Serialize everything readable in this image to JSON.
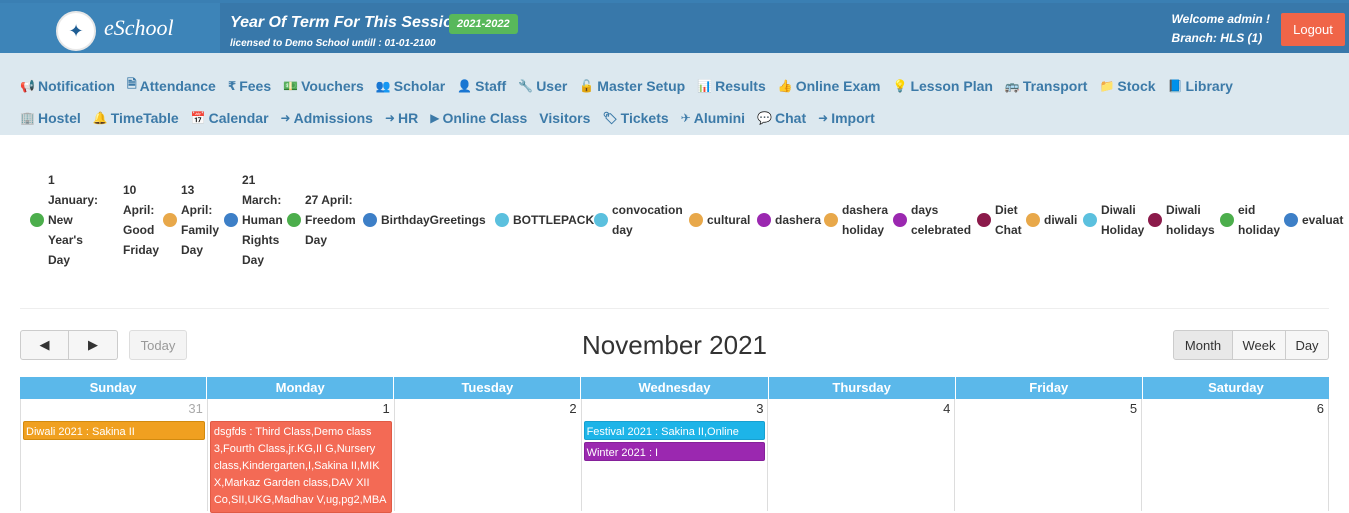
{
  "header": {
    "logo_text": "eSchool",
    "term_title": "Year Of Term For This Session :-",
    "term_badge": "2021-2022",
    "licensed": "licensed to Demo School untill : 01-01-2100",
    "welcome": "Welcome admin !",
    "branch": "Branch: HLS (1)",
    "logout": "Logout"
  },
  "nav": {
    "row1": [
      {
        "label": "Notification",
        "icon": "bullhorn-icon",
        "glyph": "📢"
      },
      {
        "label": "Attendance",
        "icon": "file-icon",
        "glyph": "🗎"
      },
      {
        "label": "Fees",
        "icon": "rupee-icon",
        "glyph": "₹"
      },
      {
        "label": "Vouchers",
        "icon": "money-icon",
        "glyph": "💵"
      },
      {
        "label": "Scholar",
        "icon": "users-icon",
        "glyph": "👥"
      },
      {
        "label": "Staff",
        "icon": "user-icon",
        "glyph": "👤"
      },
      {
        "label": "User",
        "icon": "wrench-icon",
        "glyph": "🔧"
      },
      {
        "label": "Master Setup",
        "icon": "unlock-icon",
        "glyph": "🔓"
      },
      {
        "label": "Results",
        "icon": "bar-chart-icon",
        "glyph": "📊"
      },
      {
        "label": "Online Exam",
        "icon": "thumbs-up-icon",
        "glyph": "👍"
      },
      {
        "label": "Lesson Plan",
        "icon": "lightbulb-icon",
        "glyph": "💡"
      },
      {
        "label": "Transport",
        "icon": "bus-icon",
        "glyph": "🚌"
      },
      {
        "label": "Stock",
        "icon": "folder-icon",
        "glyph": "📁"
      },
      {
        "label": "Library",
        "icon": "book-icon",
        "glyph": "📘"
      }
    ],
    "row2": [
      {
        "label": "Hostel",
        "icon": "building-icon",
        "glyph": "🏢"
      },
      {
        "label": "TimeTable",
        "icon": "bell-icon",
        "glyph": "🔔"
      },
      {
        "label": "Calendar",
        "icon": "calendar-icon",
        "glyph": "📅"
      },
      {
        "label": "Admissions",
        "icon": "sign-in-icon",
        "glyph": "➜"
      },
      {
        "label": "HR",
        "icon": "sign-in-icon",
        "glyph": "➜"
      },
      {
        "label": "Online Class",
        "icon": "play-icon",
        "glyph": "▶"
      },
      {
        "label": "Visitors",
        "icon": "",
        "glyph": ""
      },
      {
        "label": "Tickets",
        "icon": "tag-icon",
        "glyph": "🏷"
      },
      {
        "label": "Alumini",
        "icon": "plane-icon",
        "glyph": "✈"
      },
      {
        "label": "Chat",
        "icon": "comments-icon",
        "glyph": "💬"
      },
      {
        "label": "Import",
        "icon": "arrow-icon",
        "glyph": "➜"
      }
    ]
  },
  "legend": [
    {
      "text": "1 January: New Year's Day",
      "lines": [
        "1",
        "January:",
        "New",
        "Year's",
        "Day"
      ],
      "color": "#4cae4c"
    },
    {
      "text": "10 April: Good Friday",
      "lines": [
        "10",
        "April:",
        "Good",
        "Friday"
      ],
      "color": "#ffffff"
    },
    {
      "text": "13 April: Family Day",
      "lines": [
        "13",
        "April:",
        "Family",
        "Day"
      ],
      "color": "#e8a84a"
    },
    {
      "text": "21 March: Human Rights Day",
      "lines": [
        "21",
        "March:",
        "Human",
        "Rights",
        "Day"
      ],
      "color": "#3d7fc7"
    },
    {
      "text": "27 April: Freedom Day",
      "lines": [
        "27 April:",
        "Freedom",
        "Day"
      ],
      "color": "#4cae4c"
    },
    {
      "text": "BirthdayGreetings",
      "lines": [
        "BirthdayGreetings"
      ],
      "color": "#3d7fc7"
    },
    {
      "text": "BOTTLEPACK",
      "lines": [
        "BOTTLEPACK"
      ],
      "color": "#5bc0de"
    },
    {
      "text": "convocation day",
      "lines": [
        "convocation",
        "day"
      ],
      "color": "#5bc0de"
    },
    {
      "text": "cultural",
      "lines": [
        "cultural"
      ],
      "color": "#e8a84a"
    },
    {
      "text": "dashera",
      "lines": [
        "dashera"
      ],
      "color": "#9b28b0"
    },
    {
      "text": "dashera holiday",
      "lines": [
        "dashera",
        "holiday"
      ],
      "color": "#e8a84a"
    },
    {
      "text": "days celebrated",
      "lines": [
        "days",
        "celebrated"
      ],
      "color": "#9b28b0"
    },
    {
      "text": "Diet Chat",
      "lines": [
        "Diet",
        "Chat"
      ],
      "color": "#8b1a4a"
    },
    {
      "text": "diwali",
      "lines": [
        "diwali"
      ],
      "color": "#e8a84a"
    },
    {
      "text": "Diwali Holiday",
      "lines": [
        "Diwali",
        "Holiday"
      ],
      "color": "#5bc0de"
    },
    {
      "text": "Diwali holidays",
      "lines": [
        "Diwali",
        "holidays"
      ],
      "color": "#8b1a4a"
    },
    {
      "text": "eid holiday",
      "lines": [
        "eid",
        "holiday"
      ],
      "color": "#4cae4c"
    },
    {
      "text": "evaluat",
      "lines": [
        "evaluat"
      ],
      "color": "#3d7fc7"
    }
  ],
  "calendar": {
    "title": "November 2021",
    "today_label": "Today",
    "prev_icon": "◀",
    "next_icon": "▶",
    "views": [
      "Month",
      "Week",
      "Day"
    ],
    "days": [
      "Sunday",
      "Monday",
      "Tuesday",
      "Wednesday",
      "Thursday",
      "Friday",
      "Saturday"
    ],
    "week1": [
      "31",
      "1",
      "2",
      "3",
      "4",
      "5",
      "6"
    ],
    "events": {
      "diwali": "Diwali 2021 : Sakina II",
      "dsgfds": "dsgfds : Third Class,Demo class 3,Fourth Class,jr.KG,II G,Nursery class,Kindergarten,I,Sakina II,MIK X,Markaz Garden class,DAV XII Co,SII,UKG,Madhav V,ug,pg2,MBA",
      "festival": "Festival 2021 : Sakina II,Online",
      "winter": "Winter 2021 : I"
    },
    "colors": {
      "diwali": "#f0a020",
      "dsgfds": "#f36a55",
      "festival": "#1db4e8",
      "winter": "#9b28b0"
    }
  }
}
